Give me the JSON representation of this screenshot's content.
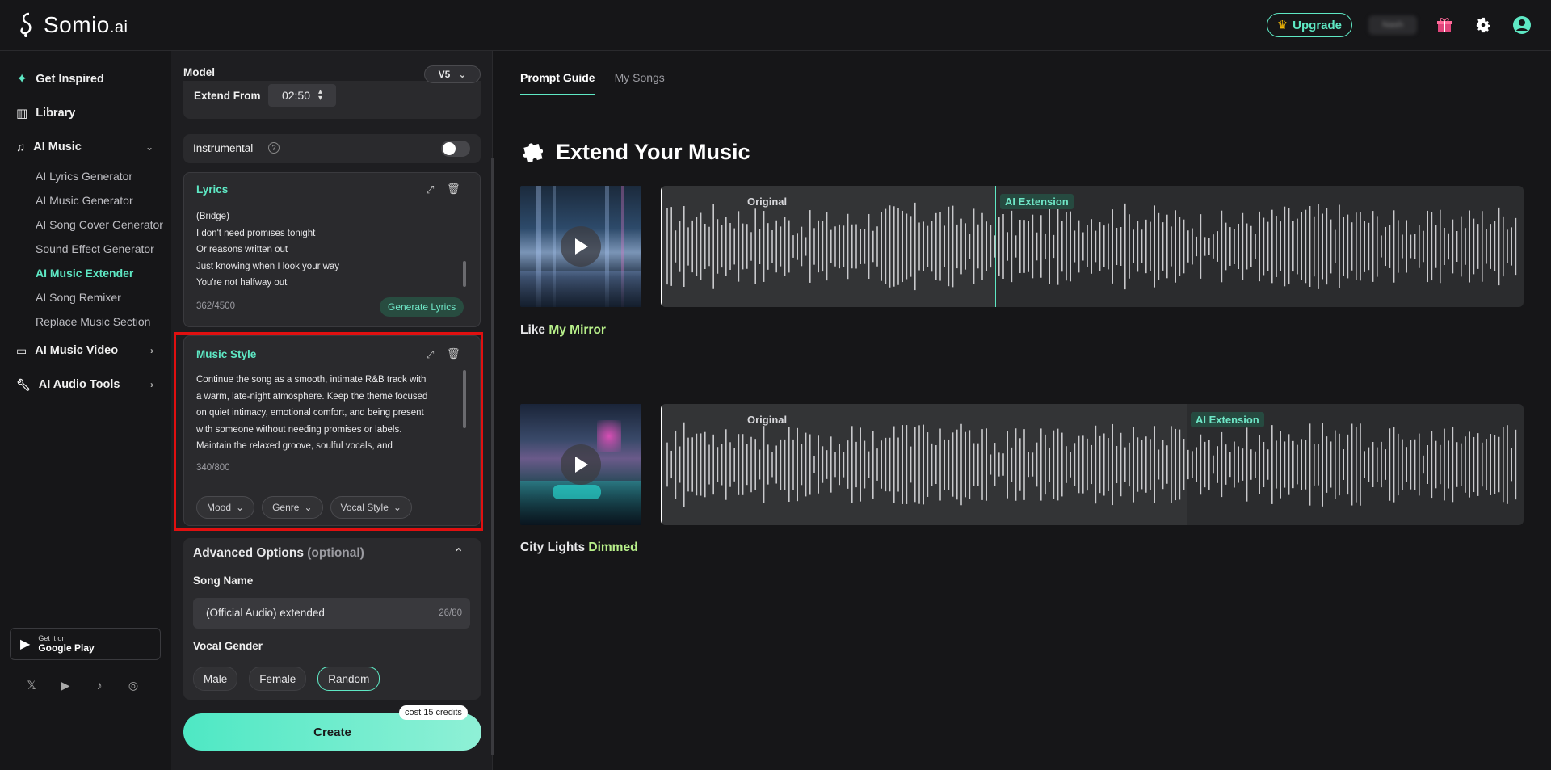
{
  "app": {
    "logo_text": "Somio",
    "logo_suffix": ".ai"
  },
  "header": {
    "upgrade_label": "Upgrade",
    "user_name": "Nash"
  },
  "sidebar": {
    "get_inspired": "Get Inspired",
    "library": "Library",
    "ai_music": "AI Music",
    "sub_items": [
      "AI Lyrics Generator",
      "AI Music Generator",
      "AI Song Cover Generator",
      "Sound Effect Generator",
      "AI Music Extender",
      "AI Song Remixer",
      "Replace Music Section"
    ],
    "active_sub": "AI Music Extender",
    "ai_music_video": "AI Music Video",
    "ai_audio_tools": "AI Audio Tools",
    "gplay_top": "Get it on",
    "gplay_bottom": "Google Play"
  },
  "form": {
    "model_label": "Model",
    "model_value": "V5",
    "extend_from_label": "Extend From",
    "extend_from_value": "02:50",
    "instrumental_label": "Instrumental",
    "lyrics": {
      "title": "Lyrics",
      "lines": [
        "(Bridge)",
        "I don't need promises tonight",
        "Or reasons written out",
        "Just knowing when I look your way",
        "You're not halfway out"
      ],
      "count": "362/4500",
      "generate_label": "Generate Lyrics"
    },
    "music_style": {
      "title": "Music Style",
      "lines": [
        "Continue the song as a smooth, intimate R&B track with",
        "a warm, late-night atmosphere. Keep the theme focused",
        "on quiet intimacy, emotional comfort, and being present",
        "with someone without needing promises or labels.",
        "Maintain the relaxed groove, soulful vocals, and"
      ],
      "count": "340/800",
      "tags": [
        "Mood",
        "Genre",
        "Vocal Style"
      ]
    },
    "advanced": {
      "title": "Advanced Options",
      "optional": "(optional)",
      "song_name_label": "Song Name",
      "song_name_value": "(Official Audio) extended",
      "song_name_count": "26/80",
      "vocal_gender_label": "Vocal Gender",
      "genders": [
        "Male",
        "Female",
        "Random"
      ],
      "selected_gender": "Random"
    },
    "create_label": "Create",
    "cost_label": "cost 15 credits"
  },
  "content": {
    "tabs": [
      "Prompt Guide",
      "My Songs"
    ],
    "active_tab": "Prompt Guide",
    "section_title": "Extend Your Music",
    "examples": [
      {
        "title_a": "Like ",
        "title_b": "My Mirror",
        "original_label": "Original",
        "extension_label": "AI Extension"
      },
      {
        "title_a": "City Lights ",
        "title_b": "Dimmed",
        "original_label": "Original",
        "extension_label": "AI Extension"
      }
    ]
  },
  "colors": {
    "accent": "#5ee8c4",
    "highlight_border": "#e01010",
    "bg": "#161618"
  }
}
